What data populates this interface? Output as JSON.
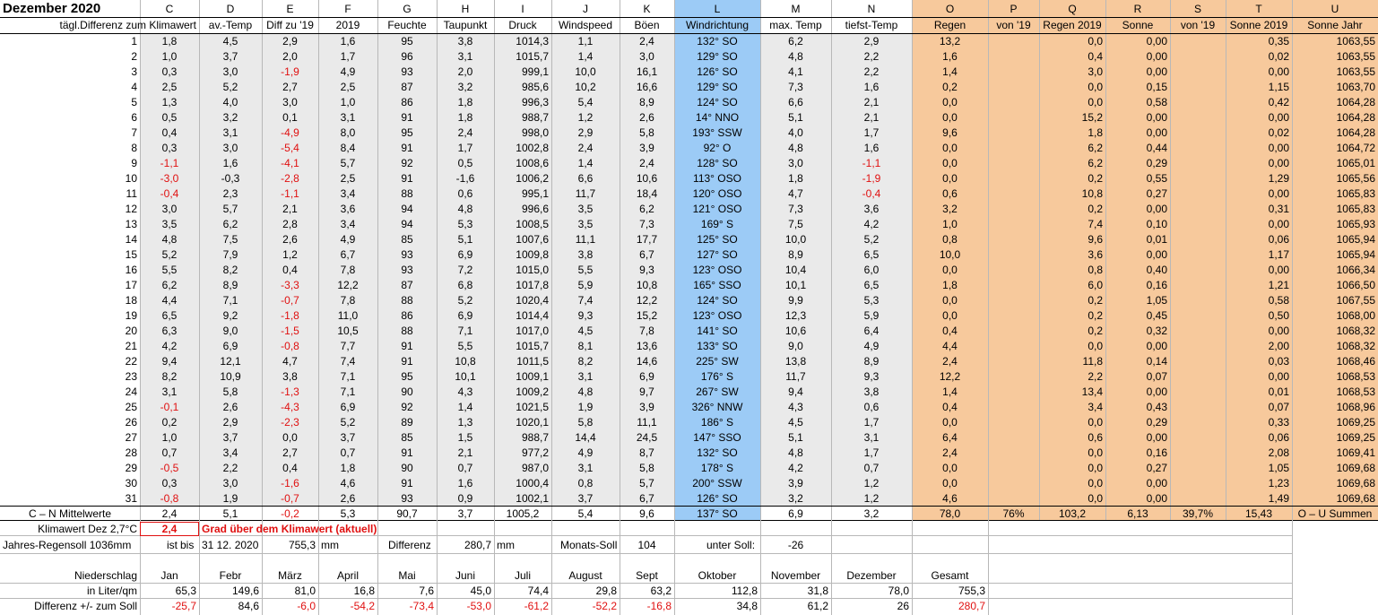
{
  "title": "Dezember 2020",
  "letters": [
    "C",
    "D",
    "E",
    "F",
    "G",
    "H",
    "I",
    "J",
    "K",
    "L",
    "M",
    "N",
    "O",
    "P",
    "Q",
    "R",
    "S",
    "T",
    "U"
  ],
  "headers": [
    "tägl.Differenz zum Klimawert",
    "av.-Temp",
    "Diff zu '19",
    "2019",
    "Feuchte",
    "Taupunkt",
    "Druck",
    "Windspeed",
    "Böen",
    "Windrichtung",
    "max. Temp",
    "tiefst-Temp",
    "Regen",
    "von '19",
    "Regen 2019",
    "Sonne",
    "von '19",
    "Sonne 2019",
    "Sonne Jahr"
  ],
  "rows": [
    [
      "1",
      "1,8",
      "4,5",
      "2,9",
      "1,6",
      "95",
      "3,8",
      "1014,3",
      "1,1",
      "2,4",
      "132° SO",
      "6,2",
      "2,9",
      "13,2",
      "",
      "0,0",
      "0,00",
      "",
      "0,35",
      "1063,55"
    ],
    [
      "2",
      "1,0",
      "3,7",
      "2,0",
      "1,7",
      "96",
      "3,1",
      "1015,7",
      "1,4",
      "3,0",
      "129° SO",
      "4,8",
      "2,2",
      "1,6",
      "",
      "0,4",
      "0,00",
      "",
      "0,02",
      "1063,55"
    ],
    [
      "3",
      "0,3",
      "3,0",
      "-1,9",
      "4,9",
      "93",
      "2,0",
      "999,1",
      "10,0",
      "16,1",
      "126° SO",
      "4,1",
      "2,2",
      "1,4",
      "",
      "3,0",
      "0,00",
      "",
      "0,00",
      "1063,55"
    ],
    [
      "4",
      "2,5",
      "5,2",
      "2,7",
      "2,5",
      "87",
      "3,2",
      "985,6",
      "10,2",
      "16,6",
      "129° SO",
      "7,3",
      "1,6",
      "0,2",
      "",
      "0,0",
      "0,15",
      "",
      "1,15",
      "1063,70"
    ],
    [
      "5",
      "1,3",
      "4,0",
      "3,0",
      "1,0",
      "86",
      "1,8",
      "996,3",
      "5,4",
      "8,9",
      "124° SO",
      "6,6",
      "2,1",
      "0,0",
      "",
      "0,0",
      "0,58",
      "",
      "0,42",
      "1064,28"
    ],
    [
      "6",
      "0,5",
      "3,2",
      "0,1",
      "3,1",
      "91",
      "1,8",
      "988,7",
      "1,2",
      "2,6",
      "14° NNO",
      "5,1",
      "2,1",
      "0,0",
      "",
      "15,2",
      "0,00",
      "",
      "0,00",
      "1064,28"
    ],
    [
      "7",
      "0,4",
      "3,1",
      "-4,9",
      "8,0",
      "95",
      "2,4",
      "998,0",
      "2,9",
      "5,8",
      "193° SSW",
      "4,0",
      "1,7",
      "9,6",
      "",
      "1,8",
      "0,00",
      "",
      "0,02",
      "1064,28"
    ],
    [
      "8",
      "0,3",
      "3,0",
      "-5,4",
      "8,4",
      "91",
      "1,7",
      "1002,8",
      "2,4",
      "3,9",
      "92° O",
      "4,8",
      "1,6",
      "0,0",
      "",
      "6,2",
      "0,44",
      "",
      "0,00",
      "1064,72"
    ],
    [
      "9",
      "-1,1",
      "1,6",
      "-4,1",
      "5,7",
      "92",
      "0,5",
      "1008,6",
      "1,4",
      "2,4",
      "128° SO",
      "3,0",
      "-1,1",
      "0,0",
      "",
      "6,2",
      "0,29",
      "",
      "0,00",
      "1065,01"
    ],
    [
      "10",
      "-3,0",
      "-0,3",
      "-2,8",
      "2,5",
      "91",
      "-1,6",
      "1006,2",
      "6,6",
      "10,6",
      "113° OSO",
      "1,8",
      "-1,9",
      "0,0",
      "",
      "0,2",
      "0,55",
      "",
      "1,29",
      "1065,56"
    ],
    [
      "11",
      "-0,4",
      "2,3",
      "-1,1",
      "3,4",
      "88",
      "0,6",
      "995,1",
      "11,7",
      "18,4",
      "120° OSO",
      "4,7",
      "-0,4",
      "0,6",
      "",
      "10,8",
      "0,27",
      "",
      "0,00",
      "1065,83"
    ],
    [
      "12",
      "3,0",
      "5,7",
      "2,1",
      "3,6",
      "94",
      "4,8",
      "996,6",
      "3,5",
      "6,2",
      "121° OSO",
      "7,3",
      "3,6",
      "3,2",
      "",
      "0,2",
      "0,00",
      "",
      "0,31",
      "1065,83"
    ],
    [
      "13",
      "3,5",
      "6,2",
      "2,8",
      "3,4",
      "94",
      "5,3",
      "1008,5",
      "3,5",
      "7,3",
      "169° S",
      "7,5",
      "4,2",
      "1,0",
      "",
      "7,4",
      "0,10",
      "",
      "0,00",
      "1065,93"
    ],
    [
      "14",
      "4,8",
      "7,5",
      "2,6",
      "4,9",
      "85",
      "5,1",
      "1007,6",
      "11,1",
      "17,7",
      "125° SO",
      "10,0",
      "5,2",
      "0,8",
      "",
      "9,6",
      "0,01",
      "",
      "0,06",
      "1065,94"
    ],
    [
      "15",
      "5,2",
      "7,9",
      "1,2",
      "6,7",
      "93",
      "6,9",
      "1009,8",
      "3,8",
      "6,7",
      "127° SO",
      "8,9",
      "6,5",
      "10,0",
      "",
      "3,6",
      "0,00",
      "",
      "1,17",
      "1065,94"
    ],
    [
      "16",
      "5,5",
      "8,2",
      "0,4",
      "7,8",
      "93",
      "7,2",
      "1015,0",
      "5,5",
      "9,3",
      "123° OSO",
      "10,4",
      "6,0",
      "0,0",
      "",
      "0,8",
      "0,40",
      "",
      "0,00",
      "1066,34"
    ],
    [
      "17",
      "6,2",
      "8,9",
      "-3,3",
      "12,2",
      "87",
      "6,8",
      "1017,8",
      "5,9",
      "10,8",
      "165° SSO",
      "10,1",
      "6,5",
      "1,8",
      "",
      "6,0",
      "0,16",
      "",
      "1,21",
      "1066,50"
    ],
    [
      "18",
      "4,4",
      "7,1",
      "-0,7",
      "7,8",
      "88",
      "5,2",
      "1020,4",
      "7,4",
      "12,2",
      "124° SO",
      "9,9",
      "5,3",
      "0,0",
      "",
      "0,2",
      "1,05",
      "",
      "0,58",
      "1067,55"
    ],
    [
      "19",
      "6,5",
      "9,2",
      "-1,8",
      "11,0",
      "86",
      "6,9",
      "1014,4",
      "9,3",
      "15,2",
      "123° OSO",
      "12,3",
      "5,9",
      "0,0",
      "",
      "0,2",
      "0,45",
      "",
      "0,50",
      "1068,00"
    ],
    [
      "20",
      "6,3",
      "9,0",
      "-1,5",
      "10,5",
      "88",
      "7,1",
      "1017,0",
      "4,5",
      "7,8",
      "141° SO",
      "10,6",
      "6,4",
      "0,4",
      "",
      "0,2",
      "0,32",
      "",
      "0,00",
      "1068,32"
    ],
    [
      "21",
      "4,2",
      "6,9",
      "-0,8",
      "7,7",
      "91",
      "5,5",
      "1015,7",
      "8,1",
      "13,6",
      "133° SO",
      "9,0",
      "4,9",
      "4,4",
      "",
      "0,0",
      "0,00",
      "",
      "2,00",
      "1068,32"
    ],
    [
      "22",
      "9,4",
      "12,1",
      "4,7",
      "7,4",
      "91",
      "10,8",
      "1011,5",
      "8,2",
      "14,6",
      "225° SW",
      "13,8",
      "8,9",
      "2,4",
      "",
      "11,8",
      "0,14",
      "",
      "0,03",
      "1068,46"
    ],
    [
      "23",
      "8,2",
      "10,9",
      "3,8",
      "7,1",
      "95",
      "10,1",
      "1009,1",
      "3,1",
      "6,9",
      "176° S",
      "11,7",
      "9,3",
      "12,2",
      "",
      "2,2",
      "0,07",
      "",
      "0,00",
      "1068,53"
    ],
    [
      "24",
      "3,1",
      "5,8",
      "-1,3",
      "7,1",
      "90",
      "4,3",
      "1009,2",
      "4,8",
      "9,7",
      "267° SW",
      "9,4",
      "3,8",
      "1,4",
      "",
      "13,4",
      "0,00",
      "",
      "0,01",
      "1068,53"
    ],
    [
      "25",
      "-0,1",
      "2,6",
      "-4,3",
      "6,9",
      "92",
      "1,4",
      "1021,5",
      "1,9",
      "3,9",
      "326° NNW",
      "4,3",
      "0,6",
      "0,4",
      "",
      "3,4",
      "0,43",
      "",
      "0,07",
      "1068,96"
    ],
    [
      "26",
      "0,2",
      "2,9",
      "-2,3",
      "5,2",
      "89",
      "1,3",
      "1020,1",
      "5,8",
      "11,1",
      "186° S",
      "4,5",
      "1,7",
      "0,0",
      "",
      "0,0",
      "0,29",
      "",
      "0,33",
      "1069,25"
    ],
    [
      "27",
      "1,0",
      "3,7",
      "0,0",
      "3,7",
      "85",
      "1,5",
      "988,7",
      "14,4",
      "24,5",
      "147° SSO",
      "5,1",
      "3,1",
      "6,4",
      "",
      "0,6",
      "0,00",
      "",
      "0,06",
      "1069,25"
    ],
    [
      "28",
      "0,7",
      "3,4",
      "2,7",
      "0,7",
      "91",
      "2,1",
      "977,2",
      "4,9",
      "8,7",
      "132° SO",
      "4,8",
      "1,7",
      "2,4",
      "",
      "0,0",
      "0,16",
      "",
      "2,08",
      "1069,41"
    ],
    [
      "29",
      "-0,5",
      "2,2",
      "0,4",
      "1,8",
      "90",
      "0,7",
      "987,0",
      "3,1",
      "5,8",
      "178° S",
      "4,2",
      "0,7",
      "0,0",
      "",
      "0,0",
      "0,27",
      "",
      "1,05",
      "1069,68"
    ],
    [
      "30",
      "0,3",
      "3,0",
      "-1,6",
      "4,6",
      "91",
      "1,6",
      "1000,4",
      "0,8",
      "5,7",
      "200° SSW",
      "3,9",
      "1,2",
      "0,0",
      "",
      "0,0",
      "0,00",
      "",
      "1,23",
      "1069,68"
    ],
    [
      "31",
      "-0,8",
      "1,9",
      "-0,7",
      "2,6",
      "93",
      "0,9",
      "1002,1",
      "3,7",
      "6,7",
      "126° SO",
      "3,2",
      "1,2",
      "4,6",
      "",
      "0,0",
      "0,00",
      "",
      "1,49",
      "1069,68"
    ]
  ],
  "summary": {
    "label": "C – N Mittelwerte",
    "values": [
      "2,4",
      "5,1",
      "-0,2",
      "5,3",
      "90,7",
      "3,7",
      "1005,2",
      "5,4",
      "9,6",
      "137° SO",
      "6,9",
      "3,2",
      "78,0",
      "76%",
      "103,2",
      "6,13",
      "39,7%",
      "15,43",
      "O – U Summen"
    ]
  },
  "klima": {
    "label": "Klimawert Dez 2,7°C",
    "value": "2,4",
    "note": "Grad über dem Klimawert (aktuell)"
  },
  "jahres": {
    "label": "Jahres-Regensoll 1036mm",
    "ist": "ist",
    "bis": "bis",
    "date": "31 12. 2020",
    "amount": "755,3",
    "unit": "mm",
    "diff_label": "Differenz",
    "diff_value": "280,7",
    "diff_unit": "mm",
    "monats_label": "Monats-Soll",
    "monats_value": "104",
    "unter_label": "unter Soll:",
    "unter_value": "-26"
  },
  "precip": {
    "label": "Niederschlag",
    "row1_label": "in Liter/qm",
    "row2_label": "Differenz  +/- zum Soll",
    "months": [
      "Jan",
      "Febr",
      "März",
      "April",
      "Mai",
      "Juni",
      "Juli",
      "August",
      "Sept",
      "Oktober",
      "November",
      "Dezember",
      "Gesamt"
    ],
    "liter": [
      "65,3",
      "149,6",
      "81,0",
      "16,8",
      "7,6",
      "45,0",
      "74,4",
      "29,8",
      "63,2",
      "112,8",
      "31,8",
      "78,0",
      "755,3"
    ],
    "diff": [
      "-25,7",
      "84,6",
      "-6,0",
      "-54,2",
      "-73,4",
      "-53,0",
      "-61,2",
      "-52,2",
      "-16,8",
      "34,8",
      "61,2",
      "26",
      "280,7"
    ]
  },
  "colors": {
    "wind_column": "#9ccbf6",
    "rain_sun_columns": "#f7c99c",
    "negative": "#e01010"
  }
}
